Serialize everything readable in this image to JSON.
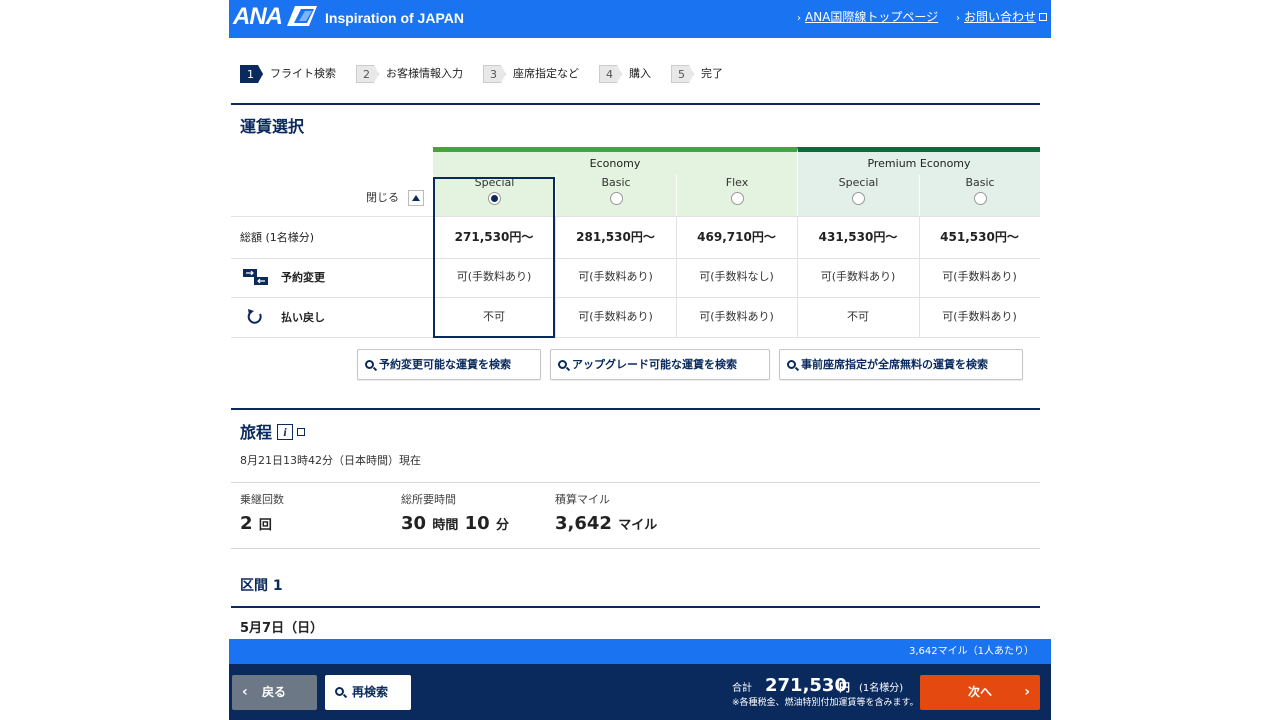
{
  "header": {
    "logo": "ANA",
    "tagline": "Inspiration of JAPAN",
    "links": [
      {
        "label": "ANA国際線トップページ"
      },
      {
        "label": "お問い合わせ"
      }
    ]
  },
  "steps": [
    {
      "num": "1",
      "label": "フライト検索"
    },
    {
      "num": "2",
      "label": "お客様情報入力"
    },
    {
      "num": "3",
      "label": "座席指定など"
    },
    {
      "num": "4",
      "label": "購入"
    },
    {
      "num": "5",
      "label": "完了"
    }
  ],
  "fare_section": {
    "title": "運賃選択",
    "close_label": "閉じる",
    "groups": [
      "Economy",
      "Premium Economy"
    ],
    "fares": [
      {
        "name": "Special",
        "group": "Economy",
        "selected": true,
        "price": "271,530円～",
        "change": "可(手数料あり)",
        "refund": "不可"
      },
      {
        "name": "Basic",
        "group": "Economy",
        "selected": false,
        "price": "281,530円～",
        "change": "可(手数料あり)",
        "refund": "可(手数料あり)"
      },
      {
        "name": "Flex",
        "group": "Economy",
        "selected": false,
        "price": "469,710円～",
        "change": "可(手数料なし)",
        "refund": "可(手数料あり)"
      },
      {
        "name": "Special",
        "group": "Premium Economy",
        "selected": false,
        "price": "431,530円～",
        "change": "可(手数料あり)",
        "refund": "不可"
      },
      {
        "name": "Basic",
        "group": "Premium Economy",
        "selected": false,
        "price": "451,530円～",
        "change": "可(手数料あり)",
        "refund": "可(手数料あり)"
      }
    ],
    "row_labels": {
      "total": "総額 (1名様分)",
      "change": "予約変更",
      "refund": "払い戻し"
    },
    "search_buttons": [
      "予約変更可能な運賃を検索",
      "アップグレード可能な運賃を検索",
      "事前座席指定が全席無料の運賃を検索"
    ]
  },
  "itinerary": {
    "title": "旅程",
    "info_icon": "i",
    "timestamp": "8月21日13時42分（日本時間）現在",
    "stats": [
      {
        "label": "乗継回数",
        "value": "2",
        "unit": "回"
      },
      {
        "label": "総所要時間",
        "value": "30",
        "unit": "時間",
        "value2": "10",
        "unit2": "分"
      },
      {
        "label": "積算マイル",
        "value": "3,642",
        "unit": "マイル"
      }
    ],
    "segment_title": "区間 1",
    "date": "5月7日（日）"
  },
  "footer": {
    "miles_note": "3,642マイル（1人あたり）",
    "back_label": "戻る",
    "research_label": "再検索",
    "total_label": "合計",
    "total_amount": "271,530",
    "total_unit": "円",
    "total_per": "(1名様分)",
    "total_note": "※各種税金、燃油特別付加運賃等を含みます。",
    "next_label": "次へ"
  },
  "colors": {
    "brand_blue": "#1a73f0",
    "navy": "#0a2a5e",
    "economy_green": "#3ea83a",
    "premium_green": "#0b6b3a",
    "next_orange": "#e44a0f"
  }
}
